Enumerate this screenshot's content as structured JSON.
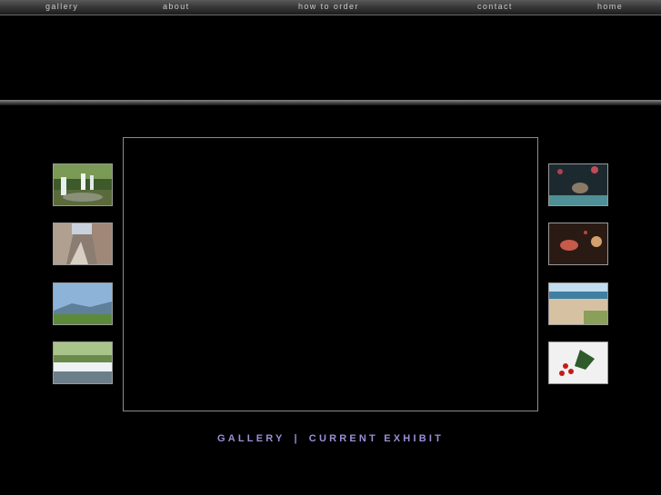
{
  "nav": {
    "gallery": "gallery",
    "about": "about",
    "how_to_order": "how to order",
    "contact": "contact",
    "home": "home"
  },
  "footer": {
    "gallery": "GALLERY",
    "separator": "|",
    "current_exhibit": "CURRENT EXHIBIT"
  },
  "colors": {
    "background": "#000000",
    "nav_text": "#c8c8c8",
    "footer_link": "#9b8fd6",
    "frame_border": "#8c8c8c"
  },
  "thumbnails": [
    {
      "name": "forest-waterfall-thumb"
    },
    {
      "name": "canyon-thumb"
    },
    {
      "name": "mountain-vista-thumb"
    },
    {
      "name": "river-falls-thumb"
    },
    {
      "name": "fish-aquarium-thumb"
    },
    {
      "name": "hermit-crab-thumb"
    },
    {
      "name": "beach-shore-thumb"
    },
    {
      "name": "holly-berries-thumb"
    }
  ]
}
